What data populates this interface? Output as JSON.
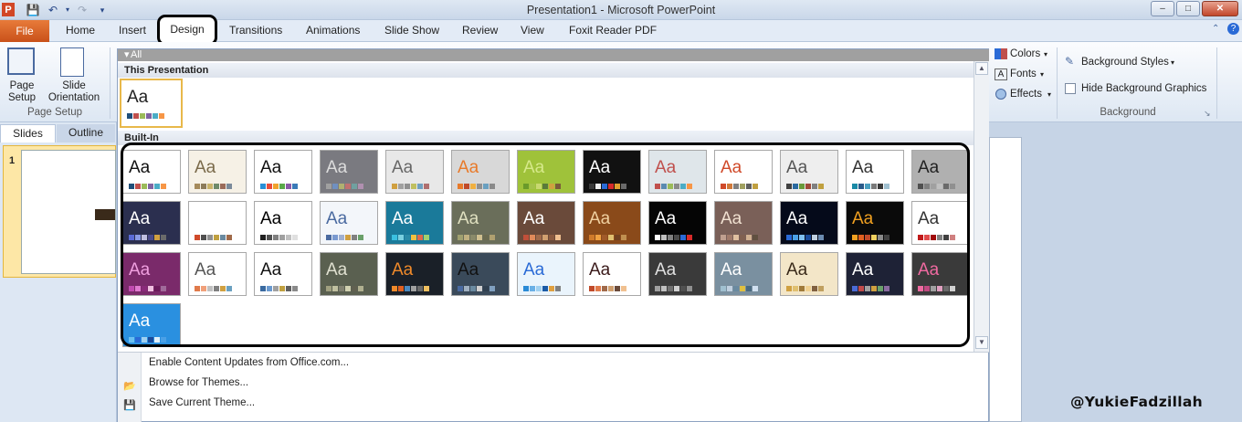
{
  "window": {
    "title": "Presentation1 - Microsoft PowerPoint",
    "minimize_icon": "minimize-icon",
    "maximize_icon": "maximize-icon",
    "close_icon": "close-icon"
  },
  "quick_access": {
    "icons": [
      "powerpoint-logo-icon",
      "save-icon",
      "undo-icon",
      "redo-icon",
      "customize-qat-icon"
    ],
    "app_letter": "P"
  },
  "tabs": [
    "File",
    "Home",
    "Insert",
    "Design",
    "Transitions",
    "Animations",
    "Slide Show",
    "Review",
    "View",
    "Foxit Reader PDF"
  ],
  "active_tab": "Design",
  "ribbon": {
    "page_setup": {
      "page_setup_label": "Page\nSetup",
      "slide_orientation_label": "Slide\nOrientation",
      "group_label": "Page Setup"
    },
    "theme_options": {
      "colors": "Colors",
      "fonts": "Fonts",
      "effects": "Effects"
    },
    "background": {
      "background_styles": "Background Styles",
      "hide_background_graphics": "Hide Background Graphics",
      "hide_checked": false,
      "group_label": "Background"
    }
  },
  "left_panel": {
    "tabs": [
      "Slides",
      "Outline"
    ],
    "slide_number": "1"
  },
  "gallery": {
    "header": "All Themes",
    "this_presentation_label": "This Presentation",
    "builtin_label": "Built-In",
    "current_theme": {
      "sample": "Aa",
      "bg": "#ffffff",
      "fg": "#111111",
      "dots": [
        "#1f4e79",
        "#c0504d",
        "#9bbb59",
        "#8064a2",
        "#4bacc6",
        "#f79646"
      ]
    },
    "themes": [
      {
        "bg": "#ffffff",
        "fg": "#111111",
        "dots": [
          "#1f4e79",
          "#c0504d",
          "#9bbb59",
          "#8064a2",
          "#4bacc6",
          "#f79646"
        ]
      },
      {
        "bg": "#f6f1e6",
        "fg": "#7a6a4a",
        "dots": [
          "#a58a5a",
          "#8c7b5a",
          "#c9b36b",
          "#6e8a6a",
          "#9a6b5a",
          "#7a8a9a"
        ]
      },
      {
        "bg": "#ffffff",
        "fg": "#111111",
        "dots": [
          "#2a8fd6",
          "#e94c3a",
          "#f0a22d",
          "#5aa84a",
          "#8a5aa8",
          "#3a7ab8"
        ]
      },
      {
        "bg": "#7a7a80",
        "fg": "#dcdcdc",
        "dots": [
          "#a0a0a0",
          "#7090c0",
          "#b0b070",
          "#c07070",
          "#70a0a0",
          "#b090b0"
        ]
      },
      {
        "bg": "#e8e8e8",
        "fg": "#666666",
        "dots": [
          "#d0a040",
          "#a0a0a0",
          "#909090",
          "#c0c060",
          "#70a0c0",
          "#b07070"
        ]
      },
      {
        "bg": "#d8d8d8",
        "fg": "#e87a2a",
        "dots": [
          "#e87a2a",
          "#c04a2a",
          "#f0b040",
          "#909090",
          "#6aa0c0",
          "#8a8a8a"
        ]
      },
      {
        "bg": "#9fc23a",
        "fg": "#d6e98a",
        "dots": [
          "#6a9a2a",
          "#a4c24a",
          "#c8d870",
          "#5a7a3a",
          "#d0a040",
          "#7a5a3a"
        ]
      },
      {
        "bg": "#111111",
        "fg": "#ffffff",
        "dots": [
          "#3a3a3a",
          "#f0f0f0",
          "#2a6ad6",
          "#d62a2a",
          "#e0a030",
          "#6a6a6a"
        ]
      },
      {
        "bg": "#dfe6ea",
        "fg": "#c0504d",
        "dots": [
          "#c0504d",
          "#5a8ab0",
          "#9bbb59",
          "#8a8a8a",
          "#4bacc6",
          "#f79646"
        ]
      },
      {
        "bg": "#ffffff",
        "fg": "#d04a2a",
        "dots": [
          "#d04a2a",
          "#d07a3a",
          "#808080",
          "#a0a060",
          "#606060",
          "#c0a040"
        ]
      },
      {
        "bg": "#eeeeee",
        "fg": "#555555",
        "dots": [
          "#404040",
          "#2a6aa0",
          "#6a9a3a",
          "#a04a3a",
          "#808080",
          "#c0a040"
        ]
      },
      {
        "bg": "#ffffff",
        "fg": "#333333",
        "dots": [
          "#1a8aa6",
          "#2a5a8a",
          "#4aa0c0",
          "#7a7a7a",
          "#3a3a3a",
          "#a0c0d0"
        ]
      },
      {
        "bg": "#b0b0b0",
        "fg": "#222222",
        "dots": [
          "#505050",
          "#808080",
          "#a0a0a0",
          "#c0c0c0",
          "#6a6a6a",
          "#909090"
        ]
      },
      {
        "bg": "#2b2f4f",
        "fg": "#ffffff",
        "dots": [
          "#5a6ad6",
          "#8a9ae6",
          "#c0c0e0",
          "#4a4a8a",
          "#d0a040",
          "#6a6a6a"
        ]
      },
      {
        "bg": "#ffffff",
        "fg": "#ffffff",
        "dots": [
          "#d04a2a",
          "#505050",
          "#909090",
          "#c0a040",
          "#6a8aa0",
          "#a06a4a"
        ]
      },
      {
        "bg": "#ffffff",
        "fg": "#000000",
        "dots": [
          "#202020",
          "#505050",
          "#808080",
          "#a0a0a0",
          "#c0c0c0",
          "#e0e0e0"
        ]
      },
      {
        "bg": "#f3f6fa",
        "fg": "#4a6aa0",
        "dots": [
          "#4a6aa0",
          "#7a9ad0",
          "#a0b0d0",
          "#d0a040",
          "#808080",
          "#6aa06a"
        ]
      },
      {
        "bg": "#1a7a9a",
        "fg": "#ffffff",
        "dots": [
          "#3ac0e0",
          "#7ad0e0",
          "#2a8aa6",
          "#f0c040",
          "#e06a4a",
          "#a0d070"
        ]
      },
      {
        "bg": "#6a6e5a",
        "fg": "#e0e0c0",
        "dots": [
          "#a0a070",
          "#c0b080",
          "#8a8a6a",
          "#d0c090",
          "#6a6a50",
          "#b0a070"
        ]
      },
      {
        "bg": "#6a4a3a",
        "fg": "#ffffff",
        "dots": [
          "#c0503a",
          "#e08a5a",
          "#a06a4a",
          "#d0a070",
          "#8a5a40",
          "#f0c090"
        ]
      },
      {
        "bg": "#8a4a1a",
        "fg": "#f0d0a0",
        "dots": [
          "#d07a2a",
          "#f0a040",
          "#a05a2a",
          "#e0c070",
          "#704020",
          "#c09050"
        ]
      },
      {
        "bg": "#050505",
        "fg": "#ffffff",
        "dots": [
          "#ffffff",
          "#c0c0c0",
          "#808080",
          "#4a4a4a",
          "#2a6ad6",
          "#d62a2a"
        ]
      },
      {
        "bg": "#7a6058",
        "fg": "#f0e0d0",
        "dots": [
          "#c0a090",
          "#a07a6a",
          "#e0c0a0",
          "#806050",
          "#d0b090",
          "#605040"
        ]
      },
      {
        "bg": "#050a1a",
        "fg": "#ffffff",
        "dots": [
          "#2a6ad6",
          "#4aa0e6",
          "#80c0f0",
          "#1a4a9a",
          "#c0d0e0",
          "#6a8ab0"
        ]
      },
      {
        "bg": "#0a0a0a",
        "fg": "#f0a020",
        "dots": [
          "#f0a020",
          "#e06020",
          "#c04a2a",
          "#f0d060",
          "#8a8a8a",
          "#404040"
        ]
      },
      {
        "bg": "#ffffff",
        "fg": "#333333",
        "dots": [
          "#c01a1a",
          "#e04a4a",
          "#a00a0a",
          "#808080",
          "#404040",
          "#d08080"
        ]
      },
      {
        "bg": "#7a2a6a",
        "fg": "#f0a0e0",
        "dots": [
          "#c04ab0",
          "#e07ad0",
          "#8a2a7a",
          "#f0c0e0",
          "#6a1a5a",
          "#a06a9a"
        ]
      },
      {
        "bg": "#ffffff",
        "fg": "#555555",
        "dots": [
          "#e07a4a",
          "#f0a07a",
          "#c0c0c0",
          "#808080",
          "#d0a040",
          "#6aa0c0"
        ]
      },
      {
        "bg": "#ffffff",
        "fg": "#111111",
        "dots": [
          "#3a6aa0",
          "#6a9ad0",
          "#a0a0a0",
          "#c0a040",
          "#606060",
          "#8a8a8a"
        ]
      },
      {
        "bg": "#5a6050",
        "fg": "#e0e0d0",
        "dots": [
          "#a0a080",
          "#c0c0a0",
          "#808070",
          "#d0d0b0",
          "#606050",
          "#b0b090"
        ]
      },
      {
        "bg": "#1a2028",
        "fg": "#f08a2a",
        "dots": [
          "#f08a2a",
          "#e06020",
          "#4a8ac0",
          "#a0a0a0",
          "#6a6a6a",
          "#f0c060"
        ]
      },
      {
        "bg": "#3a4a5a",
        "fg": "#111111",
        "dots": [
          "#4a6aa0",
          "#a0b0c0",
          "#6a8aa0",
          "#d0d0d0",
          "#304050",
          "#80a0c0"
        ]
      },
      {
        "bg": "#eaf4fc",
        "fg": "#2a6ad6",
        "dots": [
          "#2a8ad6",
          "#6ab0e6",
          "#a0d0f0",
          "#1a5aa6",
          "#e0a040",
          "#808080"
        ]
      },
      {
        "bg": "#ffffff",
        "fg": "#3a1a1a",
        "dots": [
          "#c04a2a",
          "#e07a4a",
          "#a06a4a",
          "#d0a070",
          "#6a4a3a",
          "#f0c090"
        ]
      },
      {
        "bg": "#3a3a3a",
        "fg": "#e0e0e0",
        "dots": [
          "#a0a0a0",
          "#c0c0c0",
          "#707070",
          "#d0d0d0",
          "#505050",
          "#909090"
        ]
      },
      {
        "bg": "#7a90a0",
        "fg": "#ffffff",
        "dots": [
          "#a0c0d0",
          "#c0d0e0",
          "#6a8aa0",
          "#e0c040",
          "#4a6a80",
          "#d0e0f0"
        ]
      },
      {
        "bg": "#f3e6c8",
        "fg": "#3a2a1a",
        "dots": [
          "#d0a040",
          "#e0c070",
          "#a07a3a",
          "#f0d090",
          "#806040",
          "#c0a060"
        ]
      },
      {
        "bg": "#1e2236",
        "fg": "#ffffff",
        "dots": [
          "#4a6ad6",
          "#c04a4a",
          "#a0a0a0",
          "#d0a040",
          "#6aa06a",
          "#8a6aa0"
        ]
      },
      {
        "bg": "#3a3a3a",
        "fg": "#f06aa0",
        "dots": [
          "#f06aa0",
          "#c04a80",
          "#a0a0a0",
          "#e0a0c0",
          "#6a6a6a",
          "#d0d0d0"
        ]
      },
      {
        "bg": "#2a90e0",
        "fg": "#ffffff",
        "dots": [
          "#6ac0f0",
          "#2a6ad6",
          "#a0d0f0",
          "#1a4a9a",
          "#e0f0fa",
          "#4aa0e6"
        ]
      }
    ],
    "menu": [
      "Enable Content Updates from Office.com...",
      "Browse for Themes...",
      "Save Current Theme..."
    ]
  },
  "watermark": "@YukieFadzillah"
}
